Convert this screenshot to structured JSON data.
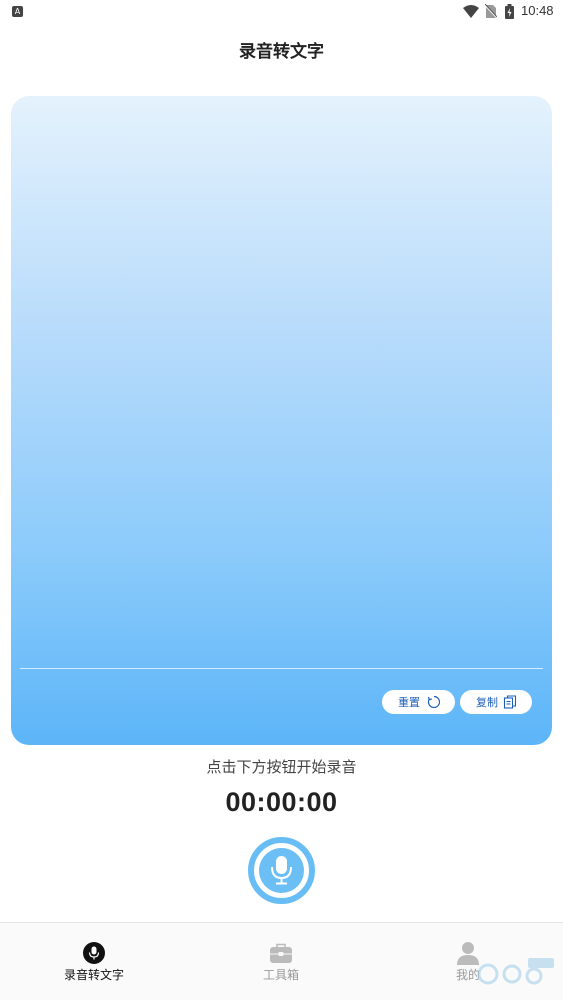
{
  "status_bar": {
    "time": "10:48",
    "notification_icon_letter": "A"
  },
  "header": {
    "title": "录音转文字"
  },
  "card": {
    "buttons": [
      {
        "label": "重置",
        "icon": "refresh-icon"
      },
      {
        "label": "复制",
        "icon": "copy-icon"
      }
    ]
  },
  "hint": "点击下方按钮开始录音",
  "timer": "00:00:00",
  "record_button": {
    "icon": "microphone-icon",
    "color": "#68bdf4"
  },
  "tabs": [
    {
      "label": "录音转文字",
      "icon": "microphone-icon",
      "active": true
    },
    {
      "label": "工具箱",
      "icon": "toolbox-icon",
      "active": false
    },
    {
      "label": "我的",
      "icon": "user-icon",
      "active": false
    }
  ],
  "colors": {
    "accent": "#5cb5f8",
    "pill_text": "#1c5fb8"
  }
}
